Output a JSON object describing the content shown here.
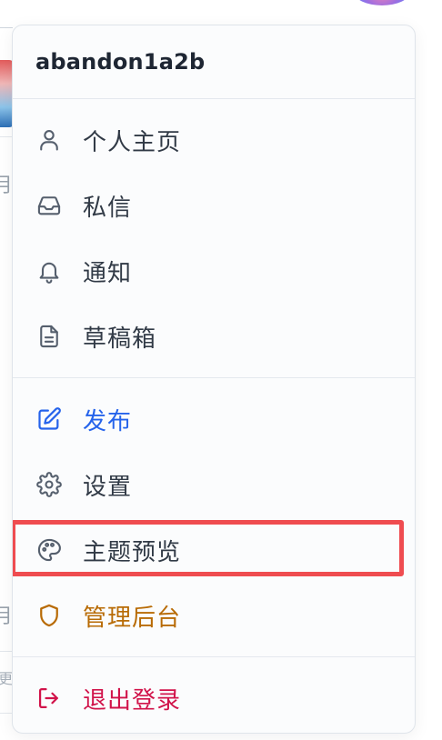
{
  "user": {
    "name": "abandon1a2b"
  },
  "menu": {
    "sections": [
      {
        "items": [
          {
            "label": "个人主页",
            "icon": "user-icon"
          },
          {
            "label": "私信",
            "icon": "inbox-icon"
          },
          {
            "label": "通知",
            "icon": "bell-icon"
          },
          {
            "label": "草稿箱",
            "icon": "document-icon"
          }
        ]
      },
      {
        "items": [
          {
            "label": "发布",
            "icon": "edit-icon",
            "color": "#2563eb"
          },
          {
            "label": "设置",
            "icon": "gear-icon"
          },
          {
            "label": "主题预览",
            "icon": "palette-icon",
            "highlighted": true
          },
          {
            "label": "管理后台",
            "icon": "shield-icon",
            "color": "#b86b05"
          }
        ]
      },
      {
        "items": [
          {
            "label": "退出登录",
            "icon": "logout-icon",
            "color": "#d1134a"
          }
        ]
      }
    ]
  },
  "background": {
    "fragments": [
      "月",
      "月",
      "更"
    ]
  },
  "colors": {
    "text": "#313a46",
    "icon": "#555f6d",
    "primary": "#2563eb",
    "warning": "#b86b05",
    "danger": "#d1134a",
    "highlight": "#ef4c50"
  }
}
